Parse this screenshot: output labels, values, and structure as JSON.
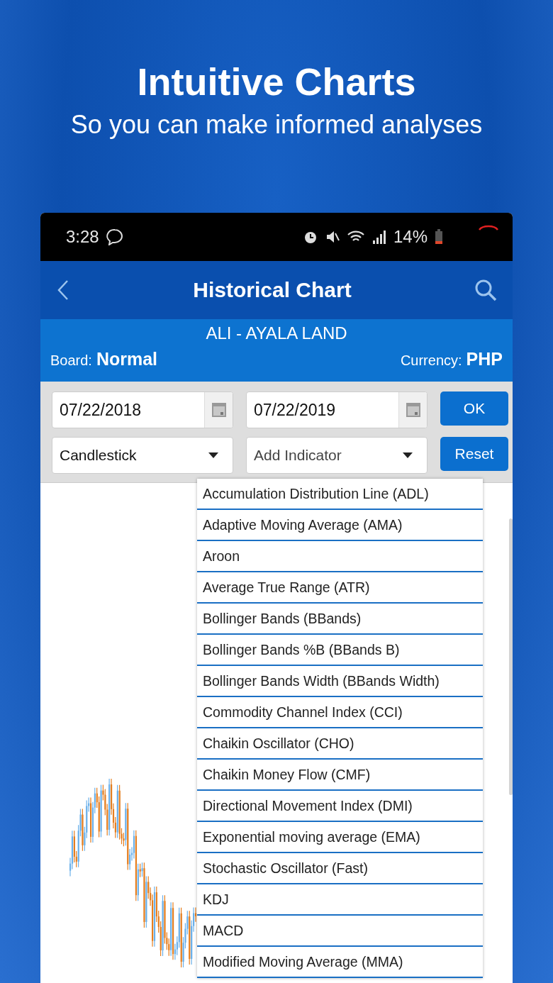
{
  "header": {
    "title": "Intuitive Charts",
    "subtitle": "So you can make informed analyses"
  },
  "status_bar": {
    "time": "3:28",
    "battery": "14%"
  },
  "app_bar": {
    "title": "Historical Chart"
  },
  "instrument": {
    "name": "ALI - AYALA LAND",
    "board_label": "Board:",
    "board": "Normal",
    "currency_label": "Currency:",
    "currency": "PHP"
  },
  "controls": {
    "start_date": "07/22/2018",
    "end_date": "07/22/2019",
    "chart_type": "Candlestick",
    "indicator": {
      "placeholder": "Add Indicator"
    },
    "buttons": [
      "OK",
      "Reset"
    ]
  },
  "indicator_menu": {
    "items": [
      "Accumulation Distribution Line (ADL)",
      "Adaptive Moving Average (AMA)",
      "Aroon",
      "Average True Range (ATR)",
      "Bollinger Bands (BBands)",
      "Bollinger Bands %B (BBands B)",
      "Bollinger Bands Width (BBands Width)",
      "Commodity Channel Index (CCI)",
      "Chaikin Oscillator (CHO)",
      "Chaikin Money Flow (CMF)",
      "Directional Movement Index (DMI)",
      "Exponential moving average (EMA)",
      "Stochastic Oscillator (Fast)",
      "KDJ",
      "MACD",
      "Modified Moving Average (MMA)"
    ]
  }
}
